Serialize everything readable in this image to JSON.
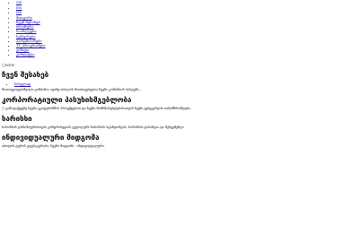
{
  "languages": [
    "GE",
    "EN",
    "DE"
  ],
  "menu": [
    "მთავარი",
    "ჩვენ შესახებ",
    "ბროშურა",
    "სიახლეები",
    "სერვისები",
    "პარტნიორები",
    "TV პროგრამები",
    "ვიზიტი",
    "კონტაქტი"
  ],
  "logo_alt": "NEW",
  "about": {
    "title": "ჩვენ შესახებ",
    "more_link": "სრულად",
    "text": "შოთაუგოგლიშვილი კომპანია იყონე თბილის მოიპოვებელია ჩვენი კომპანიის სისტემა „"
  },
  "corporate": {
    "title": "კორპორატიული პასუხისმგებლობა",
    "text": "გამოვაქვეყნე ჩვენი ეკოტურიზმის პროექტებით და ჩვენი მომხმარებლებისათვის ჩვენი ვებგვერდის თანამშრომლები."
  },
  "quality": {
    "title": "ხარისხი",
    "text": "ხარისხის განსაზღვრისთვის კონტრიბუციის ცვლილებს ხარისხის სტანდარტის, ხარისხის გარანტია და მენეჯმენტი."
  },
  "individual": {
    "title": "ინდივიდუალური მიდგომა",
    "text": "თბილის ტურის ეფესაკუროპა, ჩვენი მიდგომა - ინდივიდუალური."
  }
}
